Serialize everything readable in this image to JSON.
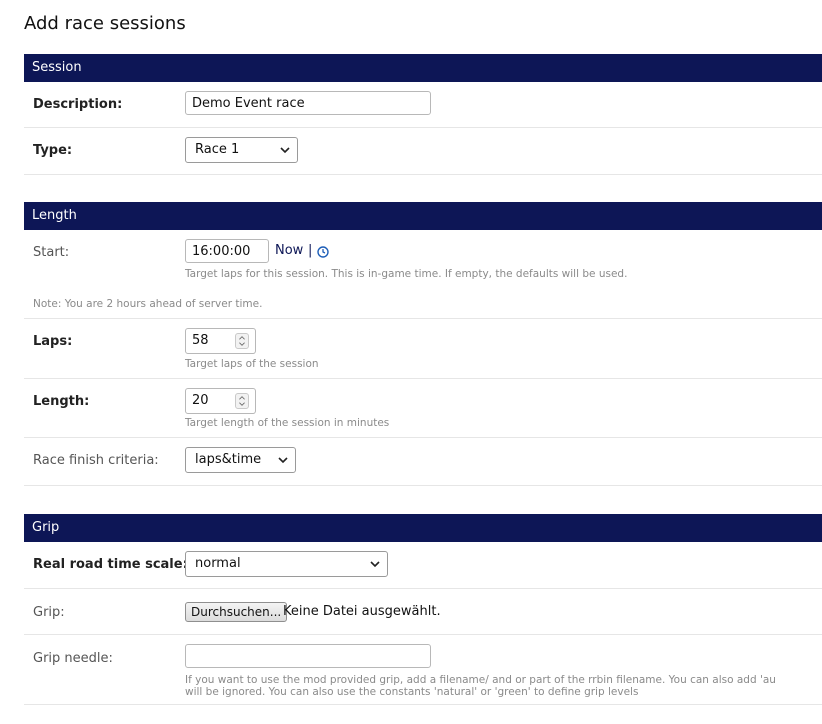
{
  "page": {
    "title": "Add race sessions"
  },
  "session": {
    "header": "Session",
    "description": {
      "label": "Description:",
      "value": "Demo Event race"
    },
    "type": {
      "label": "Type:",
      "value": "Race 1"
    }
  },
  "length": {
    "header": "Length",
    "start": {
      "label": "Start:",
      "value": "16:00:00",
      "now_link": "Now",
      "separator": "|",
      "help": "Target laps for this session. This is in-game time. If empty, the defaults will be used.",
      "note": "Note: You are 2 hours ahead of server time."
    },
    "laps": {
      "label": "Laps:",
      "value": "58",
      "help": "Target laps of the session"
    },
    "length": {
      "label": "Length:",
      "value": "20",
      "help": "Target length of the session in minutes"
    },
    "finish": {
      "label": "Race finish criteria:",
      "value": "laps&time"
    }
  },
  "grip": {
    "header": "Grip",
    "time_scale": {
      "label": "Real road time scale:",
      "value": "normal"
    },
    "grip_file": {
      "label": "Grip:",
      "button": "Durchsuchen...",
      "status": "Keine Datei ausgewählt."
    },
    "needle": {
      "label": "Grip needle:",
      "value": "",
      "help_line1": "If you want to use the mod provided grip, add a filename/ and or part of the rrbin filename. You can also add 'au",
      "help_line2": "will be ignored. You can also use the constants 'natural' or 'green' to define grip levels"
    }
  },
  "icons": {
    "clock": "clock-icon",
    "chevron": "chevron-down-icon",
    "spinner": "spinner-icon"
  },
  "colors": {
    "header_bg": "#0d1656",
    "link": "#0d1656"
  }
}
